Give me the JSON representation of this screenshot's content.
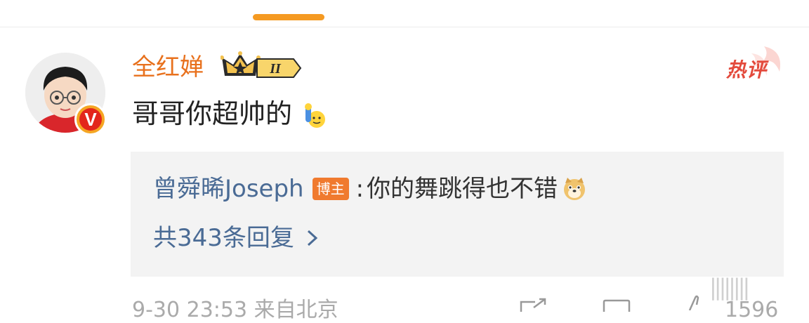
{
  "comment": {
    "username": "全红婵",
    "level_badge": "II",
    "hot_label": "热评",
    "text": "哥哥你超帅的"
  },
  "reply": {
    "author": "曾舜晞Joseph",
    "author_badge": "博主",
    "separator": ":",
    "text": "你的舞跳得也不错",
    "more_label": "共343条回复"
  },
  "meta": {
    "time_location": "9-30 23:53  来自北京",
    "like_count": "1596"
  },
  "watermark": "||||||||",
  "colors": {
    "tab_indicator": "#f59a22",
    "username": "#e8711d",
    "link": "#4a6b95",
    "hot": "#e34a3c",
    "reply_bg": "#f3f3f3"
  },
  "icons": [
    "avatar",
    "verified-icon",
    "crown-icon",
    "hot-badge-icon",
    "wave-emoji-icon",
    "doge-emoji-icon",
    "chevron-right-icon",
    "share-icon",
    "comment-icon",
    "like-icon"
  ]
}
